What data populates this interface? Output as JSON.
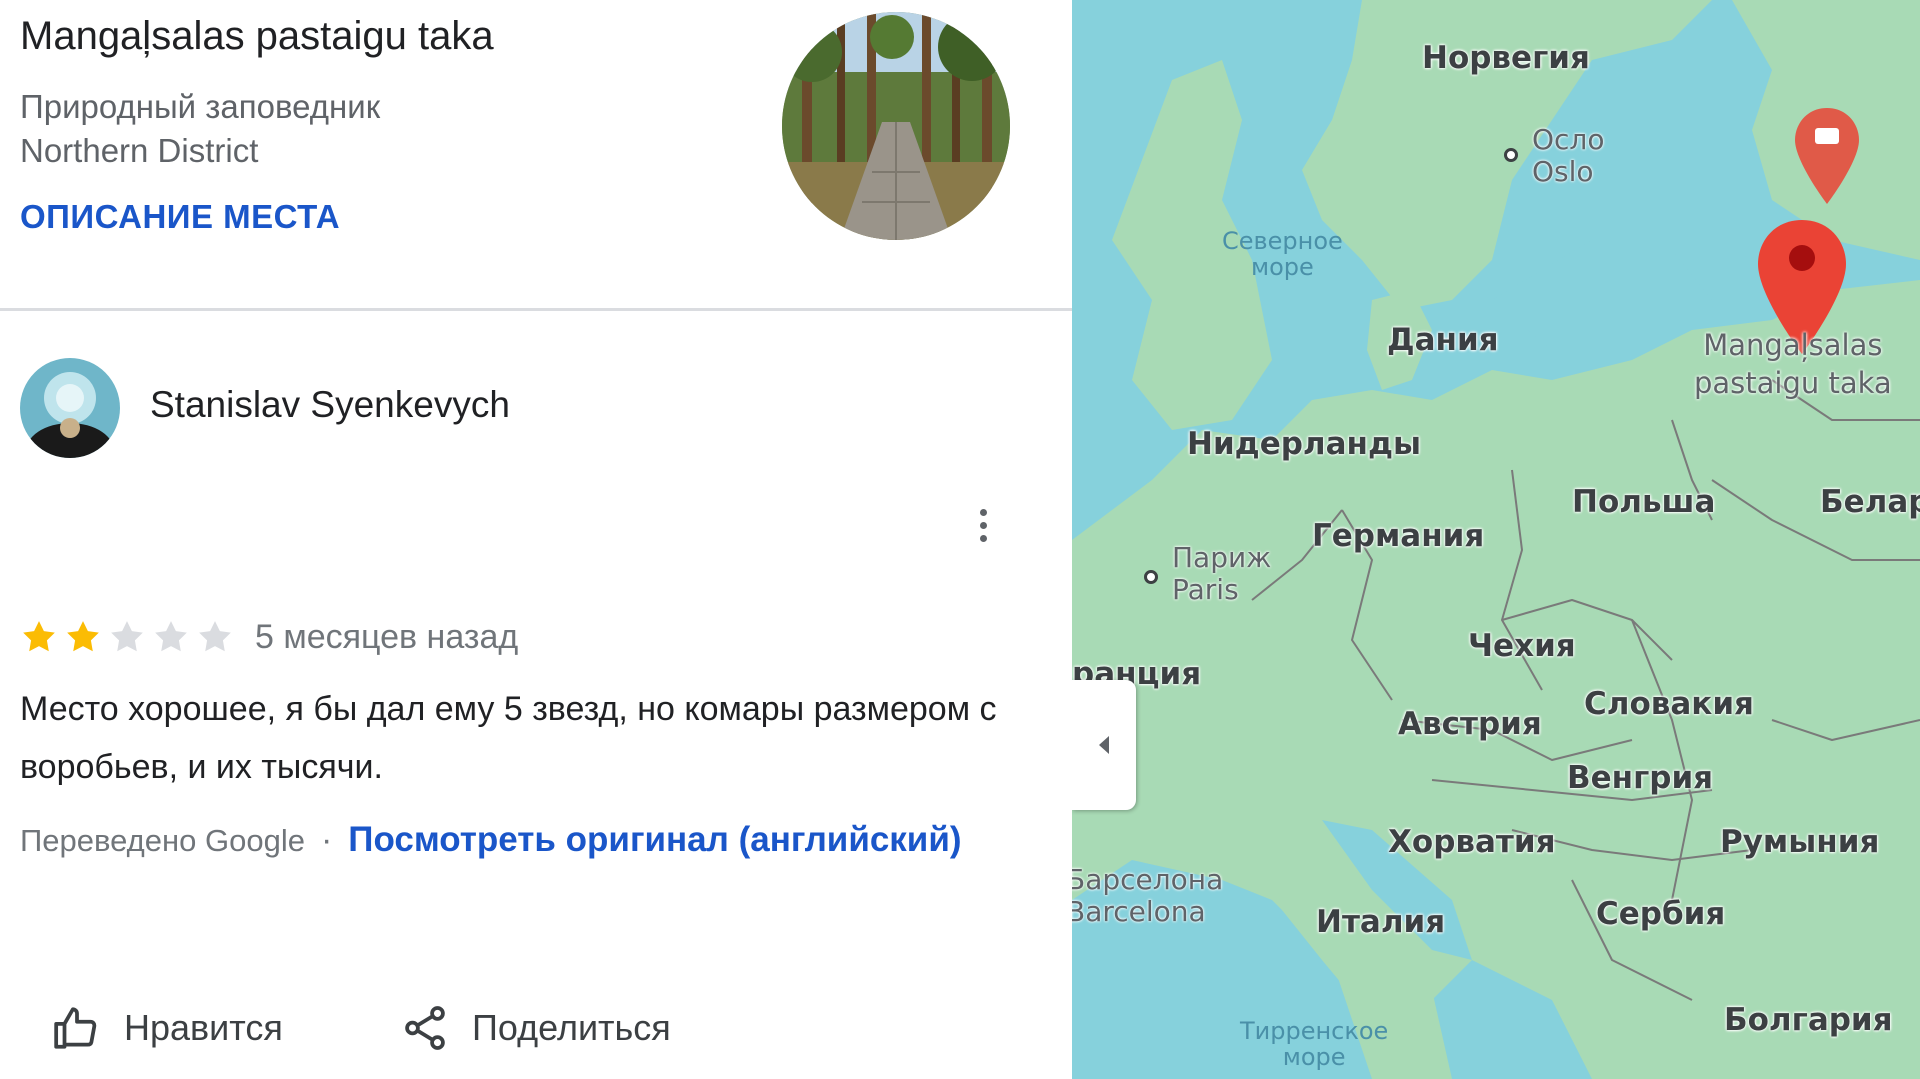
{
  "place": {
    "title": "Mangaļsalas pastaigu taka",
    "type": "Природный заповедник",
    "district": "Northern District",
    "description_link": "ОПИСАНИЕ МЕСТА"
  },
  "review": {
    "author": "Stanislav Syenkevych",
    "rating": 2,
    "max_rating": 5,
    "time": "5 месяцев назад",
    "text": "Место хорошее, я бы дал ему 5 звезд, но комары размером с воробьев, и их тысячи.",
    "translated_label": "Переведено Google",
    "separator": "·",
    "original_link": "Посмотреть оригинал (английский)"
  },
  "actions": {
    "like_label": "Нравится",
    "share_label": "Поделиться"
  },
  "map": {
    "countries": {
      "norway": "Норвегия",
      "denmark": "Дания",
      "netherlands": "Нидерланды",
      "germany": "Германия",
      "poland": "Польша",
      "belarus": "Белар",
      "czech": "Чехия",
      "france": "ранция",
      "austria": "Австрия",
      "slovakia": "Словакия",
      "hungary": "Венгрия",
      "croatia": "Хорватия",
      "romania": "Румыния",
      "italy": "Италия",
      "serbia": "Сербия",
      "bulgaria": "Болгария"
    },
    "cities": {
      "oslo_ru": "Осло",
      "oslo_en": "Oslo",
      "paris_ru": "Париж",
      "paris_en": "Paris",
      "barcelona_ru": "Барселона",
      "barcelona_en": "Barcelona"
    },
    "seas": {
      "north_sea_1": "Северное",
      "north_sea_2": "море",
      "tyrrhenian_1": "Тирренское",
      "tyrrhenian_2": "море"
    },
    "pin_label_1": "Mangaļsalas",
    "pin_label_2": "pastaigu taka",
    "colors": {
      "water": "#86d1dc",
      "land": "#a8dab5",
      "pin": "#ea4335"
    }
  },
  "colors": {
    "link": "#1a56c9",
    "star_filled": "#fbbc04",
    "star_empty": "#dadce0"
  }
}
